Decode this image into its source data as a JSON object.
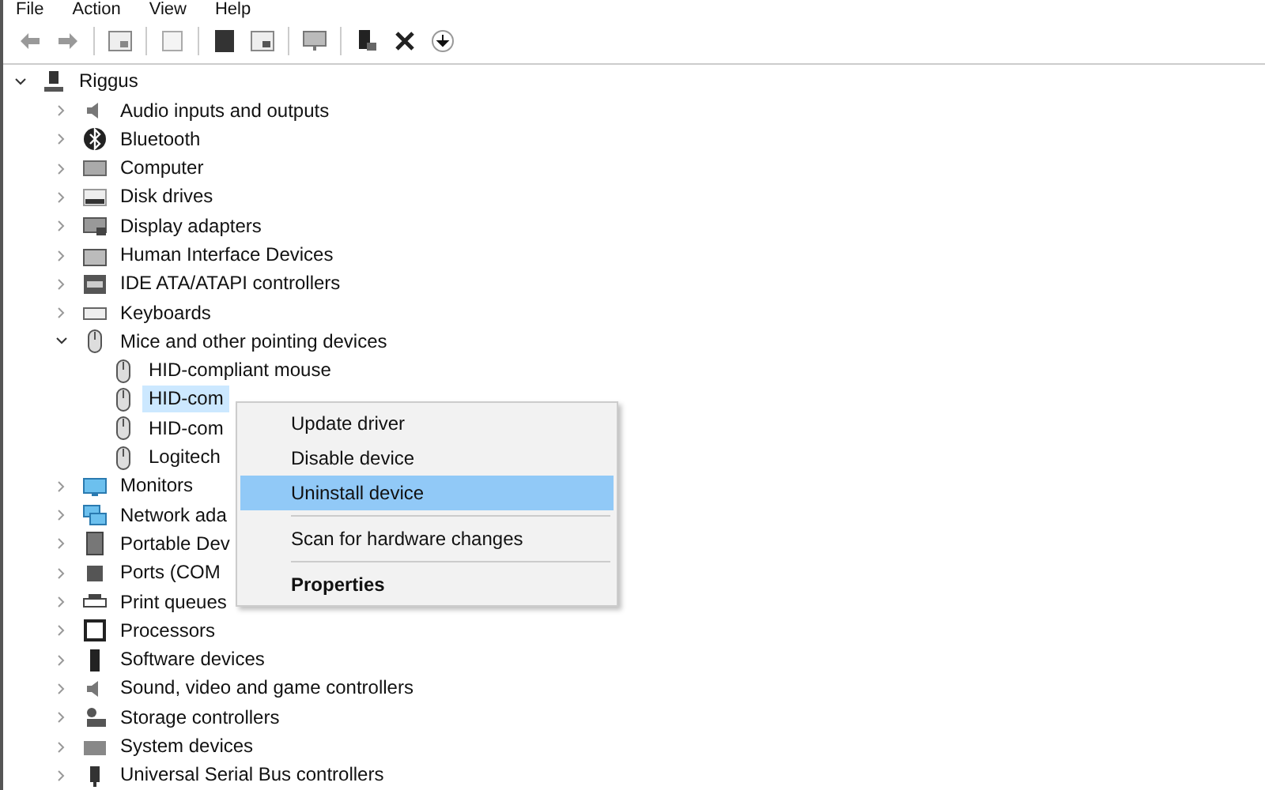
{
  "menu_bar": [
    "File",
    "Action",
    "View",
    "Help"
  ],
  "tree": {
    "label": "Riggus",
    "expanded": true,
    "children": [
      {
        "label": "Audio inputs and outputs",
        "expanded": false
      },
      {
        "label": "Bluetooth",
        "expanded": false
      },
      {
        "label": "Computer",
        "expanded": false
      },
      {
        "label": "Disk drives",
        "expanded": false
      },
      {
        "label": "Display adapters",
        "expanded": false
      },
      {
        "label": "Human Interface Devices",
        "expanded": false
      },
      {
        "label": "IDE ATA/ATAPI controllers",
        "expanded": false
      },
      {
        "label": "Keyboards",
        "expanded": false
      },
      {
        "label": "Mice and other pointing devices",
        "expanded": true,
        "children": [
          {
            "label": "HID-compliant mouse",
            "selected": false
          },
          {
            "label": "HID-com",
            "selected": true
          },
          {
            "label": "HID-com",
            "selected": false
          },
          {
            "label": "Logitech",
            "selected": false
          }
        ]
      },
      {
        "label": "Monitors",
        "expanded": false
      },
      {
        "label": "Network ada",
        "expanded": false
      },
      {
        "label": "Portable Dev",
        "expanded": false
      },
      {
        "label": "Ports (COM",
        "expanded": false
      },
      {
        "label": "Print queues",
        "expanded": false
      },
      {
        "label": "Processors",
        "expanded": false
      },
      {
        "label": "Software devices",
        "expanded": false
      },
      {
        "label": "Sound, video and game controllers",
        "expanded": false
      },
      {
        "label": "Storage controllers",
        "expanded": false
      },
      {
        "label": "System devices",
        "expanded": false
      },
      {
        "label": "Universal Serial Bus controllers",
        "expanded": false
      }
    ]
  },
  "context_menu": [
    {
      "kind": "item",
      "label": "Update driver",
      "selected": false
    },
    {
      "kind": "item",
      "label": "Disable device",
      "selected": false
    },
    {
      "kind": "item",
      "label": "Uninstall device",
      "selected": true
    },
    {
      "kind": "separator"
    },
    {
      "kind": "item",
      "label": "Scan for hardware changes",
      "selected": false
    },
    {
      "kind": "separator"
    },
    {
      "kind": "default",
      "label": "Properties",
      "selected": false
    }
  ]
}
